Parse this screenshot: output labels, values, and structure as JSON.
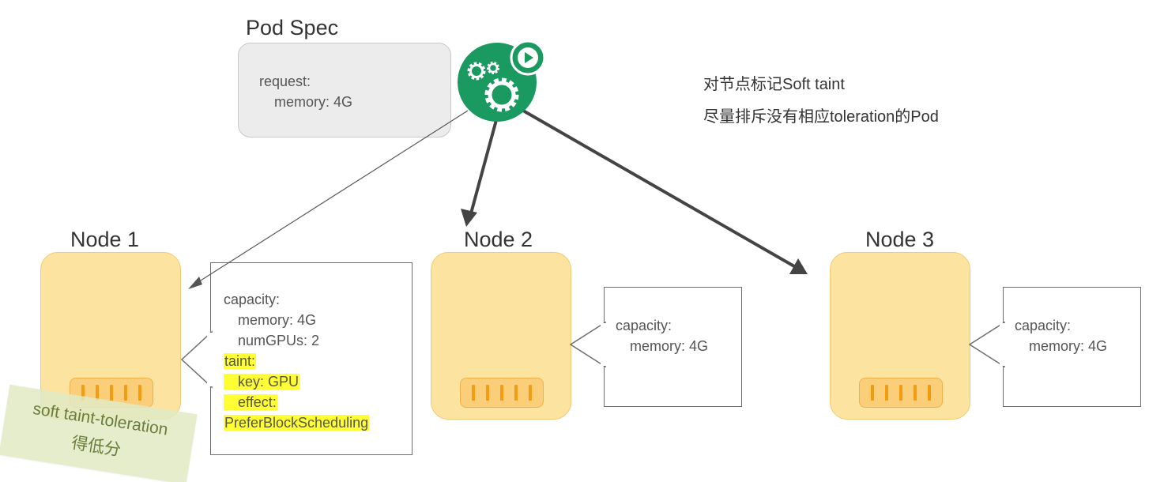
{
  "pod_spec": {
    "title": "Pod Spec",
    "request_label": "request:",
    "memory_line": "memory: 4G"
  },
  "scheduler": {
    "icon": "scheduler-gears-icon",
    "badge_icon": "play-icon",
    "color": "#1a9960"
  },
  "nodes": [
    {
      "title": "Node 1",
      "capacity": {
        "label": "capacity:",
        "memory": "memory: 4G",
        "gpus": "numGPUs: 2"
      },
      "taint": {
        "label": "taint:",
        "key": "key: GPU",
        "effect": "effect:",
        "effect_value": "PreferBlockScheduling"
      }
    },
    {
      "title": "Node 2",
      "capacity": {
        "label": "capacity:",
        "memory": "memory: 4G"
      }
    },
    {
      "title": "Node 3",
      "capacity": {
        "label": "capacity:",
        "memory": "memory: 4G"
      }
    }
  ],
  "notes": {
    "line1": "对节点标记Soft taint",
    "line2": "尽量排斥没有相应toleration的Pod"
  },
  "sticky": {
    "line1": "soft taint-toleration",
    "line2": "得低分"
  },
  "colors": {
    "node_fill": "#fde3a0",
    "chip_fill": "#fbcf7a",
    "highlight": "#ffff33",
    "arrow": "#444444"
  }
}
